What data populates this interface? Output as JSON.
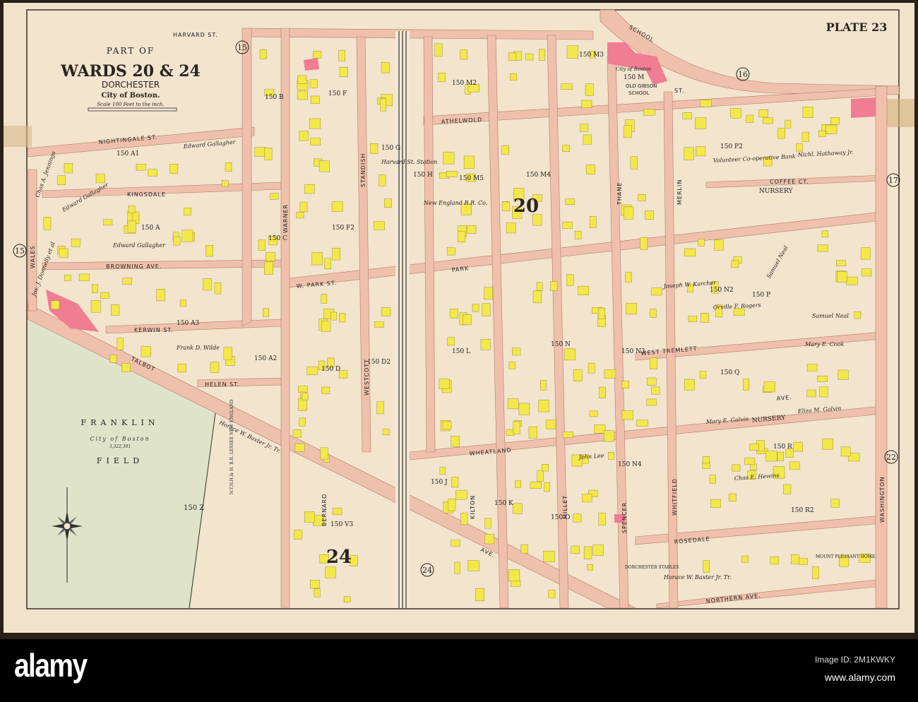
{
  "map": {
    "plate": "PLATE 23",
    "title": {
      "part_of": "PART OF",
      "wards": "WARDS 20 & 24",
      "district": "DORCHESTER",
      "city": "City of Boston.",
      "scale": "Scale 100 Feet to the inch."
    },
    "field": {
      "name1": "FRANKLIN",
      "owner": "City of Boston",
      "area": "3,322,391",
      "name2": "FIELD",
      "plot": "150 Z"
    },
    "school": {
      "owner": "City of Boston",
      "plot": "150 M",
      "name1": "OLD GIBSON",
      "name2": "SCHOOL"
    },
    "ward_numbers": [
      "20",
      "24"
    ],
    "circled_numbers": [
      "15",
      "15",
      "16",
      "17",
      "22",
      "24"
    ],
    "streets": {
      "nightingale": "NIGHTINGALE ST.",
      "kingsdale": "KINGSDALE",
      "browning": "BROWNING AVE.",
      "kerwin": "KERWIN ST.",
      "helen": "HELEN ST.",
      "talbot": "TALBOT",
      "harvard": "HARVARD ST.",
      "school": "SCHOOL",
      "school_st": "ST.",
      "athelwold": "ATHELWOLD",
      "park": "PARK",
      "w_park": "W. PARK ST.",
      "wheatland": "WHEATLAND",
      "rosedale": "ROSEDALE",
      "northern": "NORTHERN AVE.",
      "washington": "WASHINGTON",
      "west_tremlett": "WEST TREMLETT",
      "coffee": "COFFEE CT.",
      "wales": "WALES",
      "warner": "WARNER",
      "standish": "STANDISH",
      "westcott": "WESTCOTT",
      "bernard": "BERNARD",
      "kilton": "KILTON",
      "millet": "MILLET",
      "spencer": "SPENCER",
      "whitfield": "WHITFIELD",
      "thane": "THANE",
      "merlin": "MERLIN",
      "ave_lower": "AVE.",
      "ave_mid": "AVE.",
      "railroad": "N.Y.N.H.& H. R.R. LESSEE NEW ENGLAND"
    },
    "plots": [
      "150 A",
      "150 A1",
      "150 A2",
      "150 A3",
      "150 B",
      "150 C",
      "150 D",
      "150 D2",
      "150 F",
      "150 F2",
      "150 G",
      "150 H",
      "150 J",
      "150 K",
      "150 L",
      "150 M2",
      "150 M3",
      "150 M4",
      "150 M5",
      "150 N",
      "150 N2",
      "150 N3",
      "150 O",
      "150 P",
      "150 P2",
      "150 Q",
      "150 R",
      "150 R2",
      "150 V3",
      "150 N4"
    ],
    "owners": [
      "Edward Gallagher",
      "Edward Gallagher",
      "Edward Gallagher",
      "Chas A. Jennings",
      "Jos. J. Donnelly et al",
      "Frank D. Wilde",
      "Mary E. Galvin",
      "Eliza M. Galvin",
      "Chas E. Hewins",
      "Samuel Neal",
      "Samuel Neal",
      "Orville F. Rogers",
      "Mary E. Cook",
      "Horace W. Baxter Jr. Tr.",
      "Horace W. Baxter Jr. Tr.",
      "Volunteer Co-operative Bank",
      "Nichl. Hathaway Jr.",
      "Joseph W. Karcher",
      "Harvard St. Station",
      "New England R.R. Co.",
      "John Lee"
    ],
    "labels": {
      "nursery1": "NURSERY",
      "nursery2": "NURSERY",
      "stables": "DORCHESTER STABLES",
      "home": "MOUNT PLEASANT HOME"
    }
  },
  "footer": {
    "logo": "alamy",
    "image_id": "Image ID: 2M1KWKY",
    "site": "www.alamy.com"
  },
  "colors": {
    "paper": "#f1e3cb",
    "street": "#efc1ad",
    "building": "#f3e84a",
    "brick": "#f07d92",
    "park": "#dfe4c9",
    "ink": "#2b2420"
  }
}
